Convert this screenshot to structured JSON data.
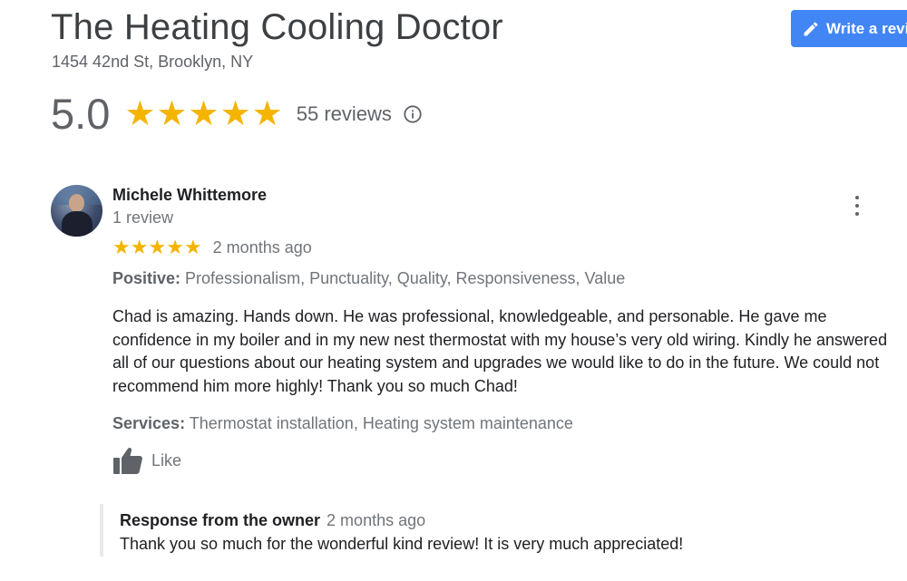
{
  "business": {
    "name": "The Heating Cooling Doctor",
    "address": "1454 42nd St, Brooklyn, NY"
  },
  "write_review": {
    "label": "Write a revi",
    "icon": "pencil-icon",
    "color": "#4285f4"
  },
  "summary": {
    "rating": "5.0",
    "stars": 5,
    "reviews_label": "55 reviews",
    "info_icon": "info-icon",
    "star_color": "#f4b400"
  },
  "review": {
    "reviewer_name": "Michele Whittemore",
    "reviewer_review_count": "1 review",
    "stars": 5,
    "time": "2 months ago",
    "positive_label": "Positive:",
    "positive_value": " Professionalism, Punctuality, Quality, Responsiveness, Value",
    "text": "Chad is amazing. Hands down. He was professional, knowledgeable, and personable. He gave me confidence in my boiler and in my new nest thermostat with my house’s very old wiring. Kindly he answered all of our questions about our heating system and upgrades we would like to do in the future. We could not recommend him more highly! Thank you so much Chad!",
    "services_label": "Services:",
    "services_value": " Thermostat installation, Heating system maintenance",
    "like_label": "Like",
    "more_icon": "more-vert-icon",
    "like_icon": "thumbs-up-icon"
  },
  "owner_response": {
    "label": "Response from the owner",
    "time": "2 months ago",
    "text": "Thank you so much for the wonderful kind review! It is very much appreciated!"
  }
}
